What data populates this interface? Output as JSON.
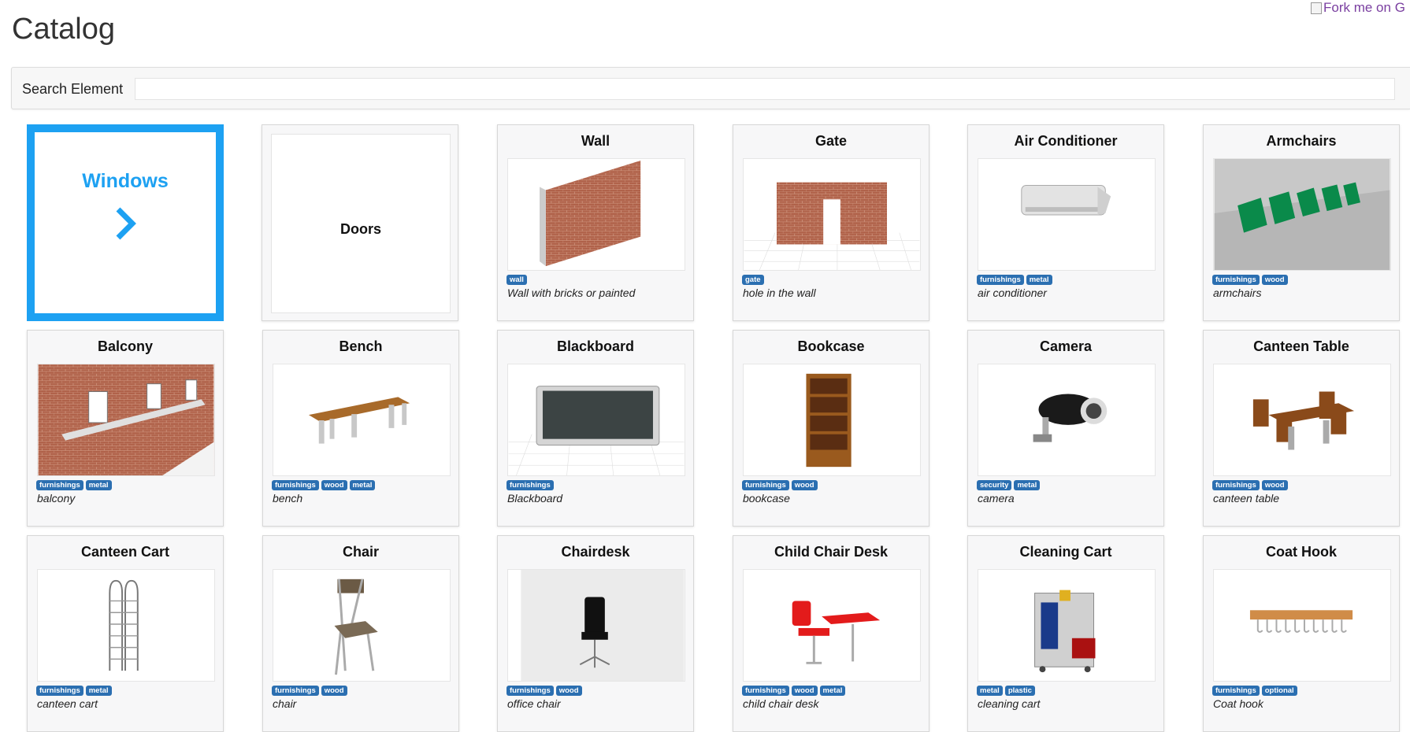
{
  "page": {
    "title": "Catalog",
    "fork_alt": "Fork me on G"
  },
  "search": {
    "label": "Search Element",
    "value": "",
    "placeholder": ""
  },
  "categories": [
    {
      "label": "Windows",
      "icon": "chevron-right-icon",
      "active": true
    },
    {
      "label": "Doors",
      "active": false
    }
  ],
  "elements": [
    {
      "title": "Wall",
      "tags": [
        "wall"
      ],
      "description": "Wall with bricks or painted",
      "icon": "wall-icon"
    },
    {
      "title": "Gate",
      "tags": [
        "gate"
      ],
      "description": "hole in the wall",
      "icon": "gate-icon"
    },
    {
      "title": "Air Conditioner",
      "tags": [
        "furnishings",
        "metal"
      ],
      "description": "air conditioner",
      "icon": "air-conditioner-icon"
    },
    {
      "title": "Armchairs",
      "tags": [
        "furnishings",
        "wood"
      ],
      "description": "armchairs",
      "icon": "armchairs-icon"
    },
    {
      "title": "Balcony",
      "tags": [
        "furnishings",
        "metal"
      ],
      "description": "balcony",
      "icon": "balcony-icon"
    },
    {
      "title": "Bench",
      "tags": [
        "furnishings",
        "wood",
        "metal"
      ],
      "description": "bench",
      "icon": "bench-icon"
    },
    {
      "title": "Blackboard",
      "tags": [
        "furnishings"
      ],
      "description": "Blackboard",
      "icon": "blackboard-icon"
    },
    {
      "title": "Bookcase",
      "tags": [
        "furnishings",
        "wood"
      ],
      "description": "bookcase",
      "icon": "bookcase-icon"
    },
    {
      "title": "Camera",
      "tags": [
        "security",
        "metal"
      ],
      "description": "camera",
      "icon": "camera-icon"
    },
    {
      "title": "Canteen Table",
      "tags": [
        "furnishings",
        "wood"
      ],
      "description": "canteen table",
      "icon": "canteen-table-icon"
    },
    {
      "title": "Canteen Cart",
      "tags": [
        "furnishings",
        "metal"
      ],
      "description": "canteen cart",
      "icon": "canteen-cart-icon"
    },
    {
      "title": "Chair",
      "tags": [
        "furnishings",
        "wood"
      ],
      "description": "chair",
      "icon": "chair-icon"
    },
    {
      "title": "Chairdesk",
      "tags": [
        "furnishings",
        "wood"
      ],
      "description": "office chair",
      "icon": "office-chair-icon"
    },
    {
      "title": "Child Chair Desk",
      "tags": [
        "furnishings",
        "wood",
        "metal"
      ],
      "description": "child chair desk",
      "icon": "child-chair-desk-icon"
    },
    {
      "title": "Cleaning Cart",
      "tags": [
        "metal",
        "plastic"
      ],
      "description": "cleaning cart",
      "icon": "cleaning-cart-icon"
    },
    {
      "title": "Coat Hook",
      "tags": [
        "furnishings",
        "optional"
      ],
      "description": "Coat hook",
      "icon": "coat-hook-icon"
    }
  ],
  "colors": {
    "accent": "#1da1f2",
    "tag": "#2b6fb1",
    "card_bg": "#f7f7f8"
  }
}
